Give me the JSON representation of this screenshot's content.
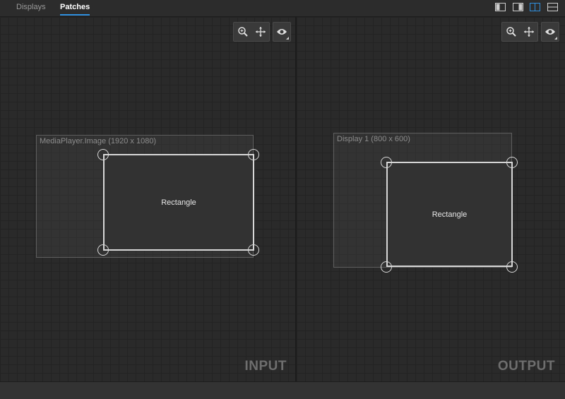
{
  "tabs": [
    {
      "label": "Displays",
      "active": false
    },
    {
      "label": "Patches",
      "active": true
    }
  ],
  "layout_buttons": [
    "left-panel-layout",
    "right-panel-layout",
    "split-vertical-layout",
    "split-horizontal-layout"
  ],
  "accent_color": "#2f8fde",
  "input_panel": {
    "title": "INPUT",
    "tools": [
      "zoom-icon",
      "pan-icon",
      "eye-icon"
    ],
    "source_label": "MediaPlayer.Image (1920 x 1080)",
    "shape_label": "Rectangle"
  },
  "output_panel": {
    "title": "OUTPUT",
    "tools": [
      "zoom-icon",
      "pan-icon",
      "eye-icon"
    ],
    "source_label": "Display 1 (800 x 600)",
    "shape_label": "Rectangle"
  }
}
